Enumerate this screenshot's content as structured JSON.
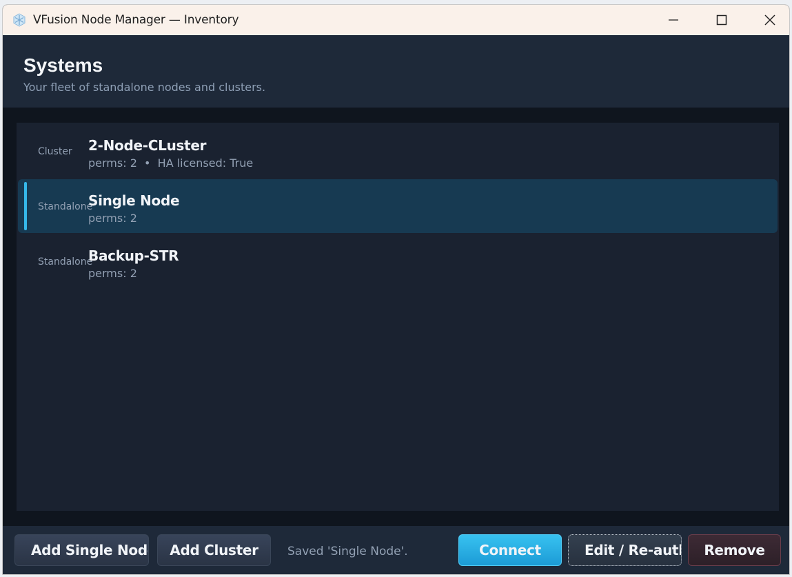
{
  "window": {
    "title": "VFusion Node Manager — Inventory"
  },
  "header": {
    "title": "Systems",
    "subtitle": "Your fleet of standalone nodes and clusters."
  },
  "systems": [
    {
      "kind": "Cluster",
      "name": "2-Node-CLuster",
      "meta": "perms: 2  •  HA licensed: True",
      "selected": false
    },
    {
      "kind": "Standalone",
      "name": "Single Node",
      "meta": "perms: 2",
      "selected": true
    },
    {
      "kind": "Standalone",
      "name": "Backup-STR",
      "meta": "perms: 2",
      "selected": false
    }
  ],
  "footer": {
    "add_single_node": "Add Single Node",
    "add_cluster": "Add Cluster",
    "status": "Saved 'Single Node'.",
    "connect": "Connect",
    "edit": "Edit / Re-auth",
    "remove": "Remove"
  },
  "colors": {
    "accent": "#35b8ea",
    "primary_button": "#26a9e0",
    "selected_row": "#173a52",
    "danger_border": "#6a3d4b"
  },
  "icons": {
    "app": "snowflake-hex-icon",
    "minimize": "minimize-icon",
    "maximize": "maximize-icon",
    "close": "close-icon"
  }
}
